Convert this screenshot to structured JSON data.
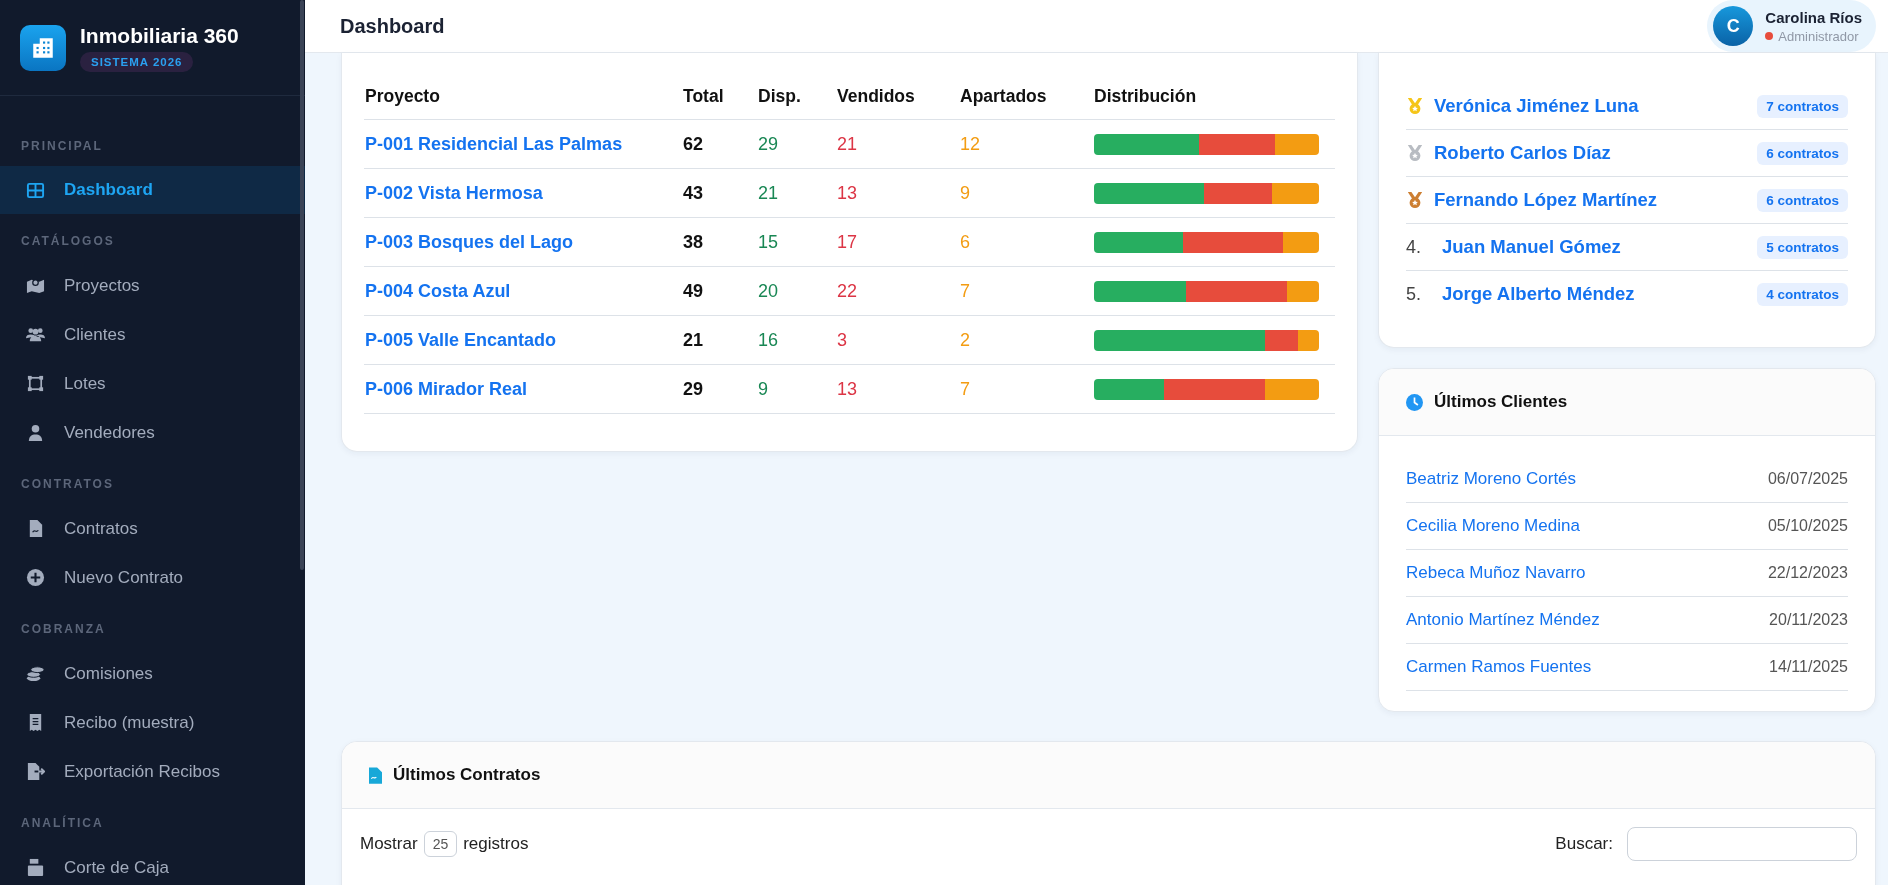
{
  "sidebar": {
    "brand": "Inmobiliaria 360",
    "badge": "SISTEMA 2026",
    "sections": [
      {
        "label": "PRINCIPAL",
        "items": [
          {
            "label": "Dashboard",
            "selected": true
          }
        ]
      },
      {
        "label": "CATÁLOGOS",
        "items": [
          {
            "label": "Proyectos",
            "selected": false
          },
          {
            "label": "Clientes",
            "selected": false
          },
          {
            "label": "Lotes",
            "selected": false
          },
          {
            "label": "Vendedores",
            "selected": false
          }
        ]
      },
      {
        "label": "CONTRATOS",
        "items": [
          {
            "label": "Contratos",
            "selected": false
          },
          {
            "label": "Nuevo Contrato",
            "selected": false
          }
        ]
      },
      {
        "label": "COBRANZA",
        "items": [
          {
            "label": "Comisiones",
            "selected": false
          },
          {
            "label": "Recibo (muestra)",
            "selected": false
          },
          {
            "label": "Exportación Recibos",
            "selected": false
          }
        ]
      },
      {
        "label": "ANALÍTICA",
        "items": [
          {
            "label": "Corte de Caja",
            "selected": false
          }
        ]
      }
    ]
  },
  "header": {
    "title": "Dashboard",
    "user": {
      "avatar": "C",
      "name": "Carolina Ríos",
      "role": "Administrador"
    }
  },
  "projects": {
    "columns": [
      "Proyecto",
      "Total",
      "Disp.",
      "Vendidos",
      "Apartados",
      "Distribución"
    ],
    "rows": [
      {
        "project": "P-001 Residencial Las Palmas",
        "total": "62",
        "available": "29",
        "sold": "21",
        "reserved": "12"
      },
      {
        "project": "P-002 Vista Hermosa",
        "total": "43",
        "available": "21",
        "sold": "13",
        "reserved": "9"
      },
      {
        "project": "P-003 Bosques del Lago",
        "total": "38",
        "available": "15",
        "sold": "17",
        "reserved": "6"
      },
      {
        "project": "P-004 Costa Azul",
        "total": "49",
        "available": "20",
        "sold": "22",
        "reserved": "7"
      },
      {
        "project": "P-005 Valle Encantado",
        "total": "21",
        "available": "16",
        "sold": "3",
        "reserved": "2"
      },
      {
        "project": "P-006 Mirador Real",
        "total": "29",
        "available": "9",
        "sold": "13",
        "reserved": "7"
      }
    ]
  },
  "ranking": {
    "items": [
      {
        "kind": "medal",
        "color": "#f5c518",
        "name": "Verónica Jiménez Luna",
        "count": "7 contratos"
      },
      {
        "kind": "medal",
        "color": "#b8bcc2",
        "name": "Roberto Carlos Díaz",
        "count": "6 contratos"
      },
      {
        "kind": "medal",
        "color": "#cd7f32",
        "name": "Fernando López Martínez",
        "count": "6 contratos"
      },
      {
        "kind": "number",
        "rank": "4.",
        "name": "Juan Manuel Gómez",
        "count": "5 contratos"
      },
      {
        "kind": "number",
        "rank": "5.",
        "name": "Jorge Alberto Méndez",
        "count": "4 contratos"
      }
    ]
  },
  "clients": {
    "title": "Últimos Clientes",
    "rows": [
      {
        "name": "Beatriz Moreno Cortés",
        "date": "06/07/2025"
      },
      {
        "name": "Cecilia Moreno Medina",
        "date": "05/10/2025"
      },
      {
        "name": "Rebeca Muñoz Navarro",
        "date": "22/12/2023"
      },
      {
        "name": "Antonio Martínez Méndez",
        "date": "20/11/2023"
      },
      {
        "name": "Carmen Ramos Fuentes",
        "date": "14/11/2025"
      }
    ]
  },
  "contracts": {
    "title": "Últimos Contratos",
    "show_label": "Mostrar",
    "page_size": "25",
    "records_label": "registros",
    "search_label": "Buscar:"
  }
}
